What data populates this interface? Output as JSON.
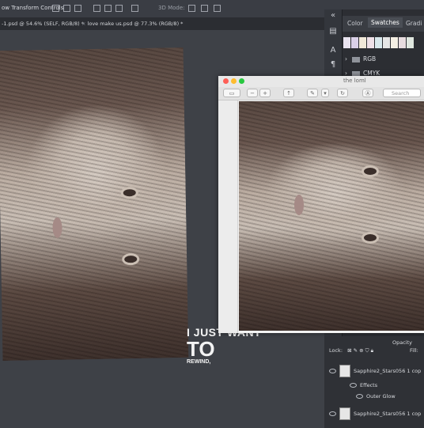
{
  "options_bar": {
    "label": "ow Transform Controls",
    "mode": "3D Mode:"
  },
  "doc_tabs": [
    {
      "label": "-1.psd @ 54.6% (SELF, RGB/8) *",
      "close": "×"
    },
    {
      "label": "love make us.psd @ 77.3% (RGB/8) *",
      "close": "×"
    }
  ],
  "panel": {
    "collapse_glyph": "«",
    "tabs": [
      "Color",
      "Swatches",
      "Gradi"
    ],
    "active_tab": "Swatches",
    "swatch_colors": [
      "#e9e3ef",
      "#dad0e8",
      "#f1e9d9",
      "#efe1e8",
      "#d9e8ec",
      "#e6e6e6",
      "#f4efe4",
      "#e7dcdf",
      "#dfe7df"
    ],
    "folders": [
      {
        "label": "RGB"
      },
      {
        "label": "CMYK"
      }
    ]
  },
  "preview_window": {
    "title": "the loml",
    "search_placeholder": "Search",
    "traffic_lights": [
      "#fe5f57",
      "#febc2e",
      "#28c840"
    ]
  },
  "overlay_text": {
    "line1": "I JUST WANT",
    "line2": "TO",
    "line3": "REWIND,"
  },
  "layers_panel": {
    "lock_label": "Lock:",
    "fill_label": "Fill:",
    "opacity_label": "Opacity",
    "rows": [
      {
        "label": "Sapphire2_Stars056 1 cop"
      },
      {
        "label": "Effects"
      },
      {
        "label": "Outer Glow"
      },
      {
        "label": "Sapphire2_Stars056 1 cop"
      }
    ]
  }
}
